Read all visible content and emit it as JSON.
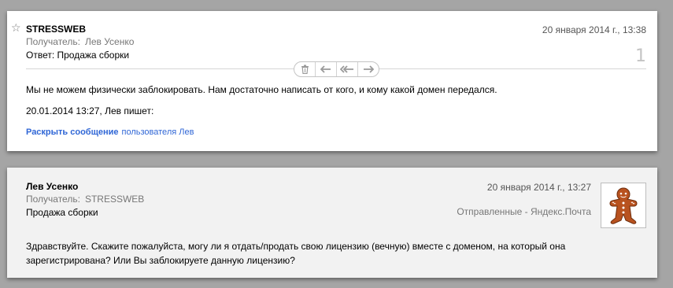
{
  "message1": {
    "sender": "STRESSWEB",
    "recipient_label": "Получатель:",
    "recipient": "Лев Усенко",
    "subject": "Ответ: Продажа сборки",
    "date": "20 января 2014 г., 13:38",
    "thread_count": "1",
    "body_line1": "Мы не можем физически заблокировать. Нам достаточно написать от кого, и кому какой домен передался.",
    "quote_header": "20.01.2014 13:27, Лев пишет:",
    "expand_link": "Раскрыть сообщение",
    "expand_rest": "пользователя Лев",
    "toolbar_icons": [
      "trash-icon",
      "reply-icon",
      "reply-all-icon",
      "forward-icon"
    ]
  },
  "message2": {
    "sender": "Лев Усенко",
    "recipient_label": "Получатель:",
    "recipient": "STRESSWEB",
    "subject": "Продажа сборки",
    "date": "20 января 2014 г., 13:27",
    "folder": "Отправленные - Яндекс.Почта",
    "body_line1": "Здравствуйте. Скажите пожалуйста, могу ли я отдать/продать свою лицензию (вечную) вместе с доменом, на который она",
    "body_line2": "зарегистрирована? Или Вы заблокируете данную лицензию?",
    "avatar_icon": "gingerbread-man-icon"
  }
}
